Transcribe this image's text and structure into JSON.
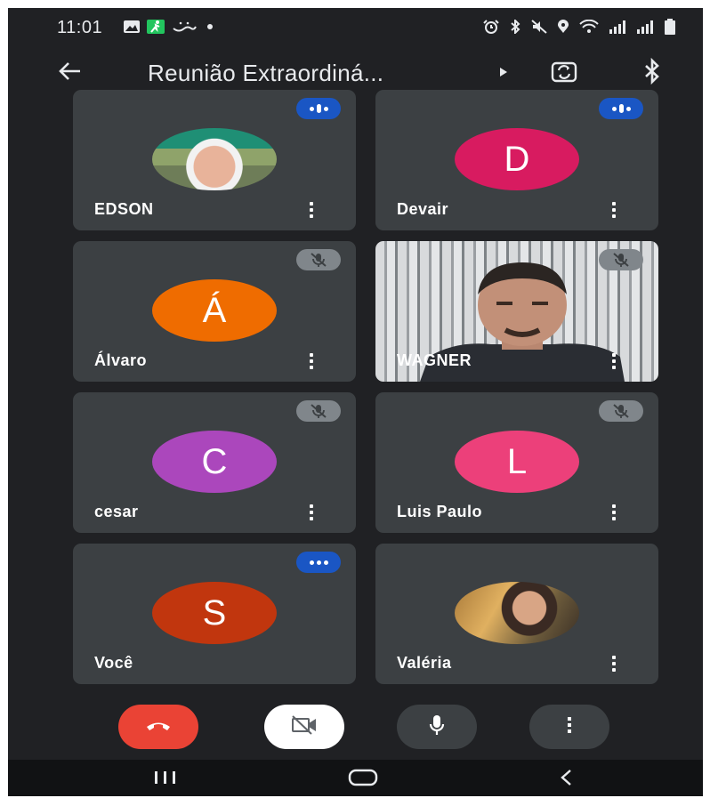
{
  "status_bar": {
    "time": "11:01",
    "left_icons": [
      "image-icon",
      "fitness-icon",
      "arabic-text-icon",
      "dot-icon"
    ],
    "right_icons": [
      "alarm-icon",
      "bluetooth-icon",
      "mute-icon",
      "location-icon",
      "wifi-icon",
      "signal-icon",
      "signal-icon",
      "battery-icon"
    ]
  },
  "app_bar": {
    "title": "Reunião Extraordiná...",
    "icons": [
      "back-arrow-icon",
      "chevron-right-icon",
      "switch-camera-icon",
      "bluetooth-audio-icon"
    ]
  },
  "participants": [
    {
      "name": "EDSON",
      "avatar_type": "photo",
      "audio": "speaking"
    },
    {
      "name": "Devair",
      "initial": "D",
      "avatar_color": "#d81b60",
      "audio": "speaking"
    },
    {
      "name": "Álvaro",
      "initial": "Á",
      "avatar_color": "#ef6c00",
      "audio": "muted"
    },
    {
      "name": "WAGNER",
      "avatar_type": "video",
      "audio": "muted"
    },
    {
      "name": "cesar",
      "initial": "C",
      "avatar_color": "#ab47bc",
      "audio": "muted"
    },
    {
      "name": "Luis Paulo",
      "initial": "L",
      "avatar_color": "#ec407a",
      "audio": "muted"
    },
    {
      "name": "Você",
      "initial": "S",
      "avatar_color": "#c1360e",
      "audio": "speaking"
    },
    {
      "name": "Valéria",
      "avatar_type": "photo",
      "audio": "none"
    }
  ],
  "controls": [
    {
      "name": "end-call",
      "icon": "phone-hangup-icon",
      "color": "#ea4335"
    },
    {
      "name": "camera",
      "icon": "video-off-icon",
      "color": "#ffffff"
    },
    {
      "name": "microphone",
      "icon": "mic-icon",
      "color": "#3c4043"
    },
    {
      "name": "more-options",
      "icon": "more-vert-icon",
      "color": "#3c4043"
    }
  ],
  "nav_bar": {
    "icons": [
      "recents-icon",
      "home-icon",
      "back-icon"
    ]
  }
}
